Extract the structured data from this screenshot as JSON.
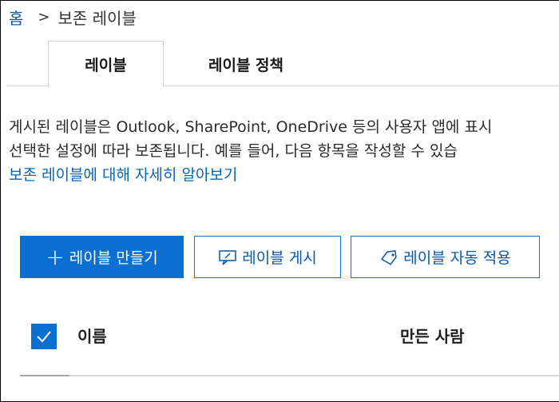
{
  "breadcrumb": {
    "home": "홈",
    "separator": ">",
    "current": "보존 레이블"
  },
  "tabs": [
    {
      "label": "레이블",
      "active": true
    },
    {
      "label": "레이블 정책",
      "active": false
    }
  ],
  "description": {
    "line1": "게시된 레이블은 Outlook, SharePoint, OneDrive 등의 사용자 앱에 표시",
    "line2": "선택한 설정에 따라 보존됩니다. 예를 들어, 다음 항목을 작성할 수 있습",
    "learn_more": "보존 레이블에 대해 자세히 알아보기"
  },
  "toolbar": {
    "create_label": "레이블 만들기",
    "publish_label": "레이블 게시",
    "auto_apply_label": "레이블 자동 적용",
    "plus_icon": "+"
  },
  "table": {
    "columns": {
      "name": "이름",
      "created_by": "만든 사람"
    },
    "select_all_checked": true
  },
  "colors": {
    "accent": "#0a6fd1",
    "link": "#0a58a8"
  },
  "icons": {
    "create": "plus-icon",
    "publish": "publish-icon",
    "auto_apply": "tag-icon",
    "checkbox": "checkmark-icon"
  }
}
